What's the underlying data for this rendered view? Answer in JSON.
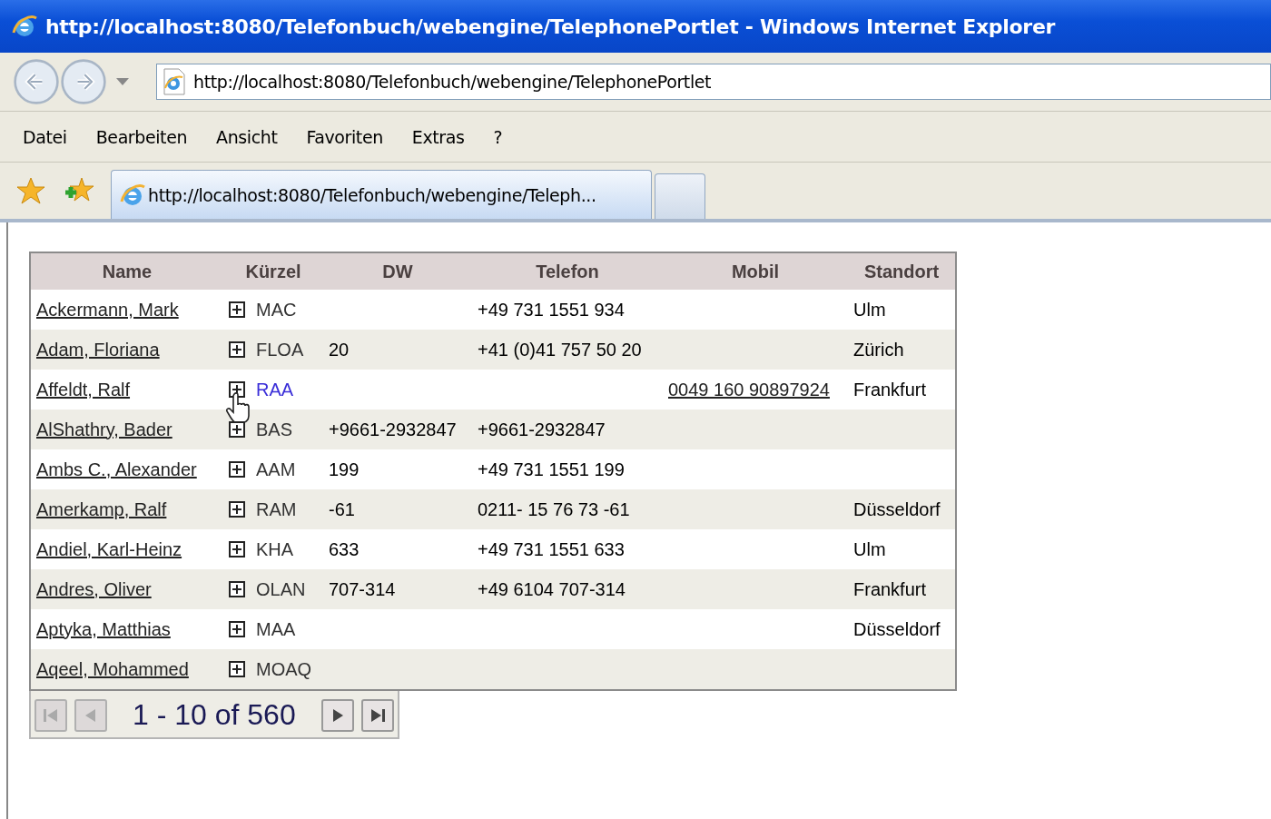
{
  "window": {
    "title": "http://localhost:8080/Telefonbuch/webengine/TelephonePortlet - Windows Internet Explorer"
  },
  "address_bar": {
    "value": "http://localhost:8080/Telefonbuch/webengine/TelephonePortlet"
  },
  "menu": [
    "Datei",
    "Bearbeiten",
    "Ansicht",
    "Favoriten",
    "Extras",
    "?"
  ],
  "tabs": [
    {
      "label": "http://localhost:8080/Telefonbuch/webengine/Teleph...",
      "selected": true
    }
  ],
  "table": {
    "columns": [
      "Name",
      "Kürzel",
      "DW",
      "Telefon",
      "Mobil",
      "Standort"
    ],
    "rows": [
      {
        "name": "Ackermann, Mark",
        "kuerzel": "MAC",
        "hovered": false,
        "dw": "",
        "telefon": "+49 731 1551 934",
        "mobil": "",
        "standort": "Ulm"
      },
      {
        "name": "Adam, Floriana",
        "kuerzel": "FLOA",
        "hovered": false,
        "dw": "20",
        "telefon": "+41 (0)41 757 50 20",
        "mobil": "",
        "standort": "Zürich"
      },
      {
        "name": "Affeldt, Ralf",
        "kuerzel": "RAA",
        "hovered": true,
        "dw": "",
        "telefon": "",
        "mobil": "0049 160 90897924",
        "standort": "Frankfurt"
      },
      {
        "name": "AlShathry, Bader",
        "kuerzel": "BAS",
        "hovered": false,
        "dw": "+9661-2932847",
        "telefon": "+9661-2932847",
        "mobil": "",
        "standort": ""
      },
      {
        "name": "Ambs C., Alexander",
        "kuerzel": "AAM",
        "hovered": false,
        "dw": "199",
        "telefon": "+49 731 1551 199",
        "mobil": "",
        "standort": ""
      },
      {
        "name": "Amerkamp, Ralf",
        "kuerzel": "RAM",
        "hovered": false,
        "dw": "-61",
        "telefon": "0211- 15 76 73 -61",
        "mobil": "",
        "standort": "Düsseldorf"
      },
      {
        "name": "Andiel, Karl-Heinz",
        "kuerzel": "KHA",
        "hovered": false,
        "dw": "633",
        "telefon": "+49 731 1551 633",
        "mobil": "",
        "standort": "Ulm"
      },
      {
        "name": "Andres, Oliver",
        "kuerzel": "OLAN",
        "hovered": false,
        "dw": "707-314",
        "telefon": "+49 6104 707-314",
        "mobil": "",
        "standort": "Frankfurt"
      },
      {
        "name": "Aptyka, Matthias",
        "kuerzel": "MAA",
        "hovered": false,
        "dw": "",
        "telefon": "",
        "mobil": "",
        "standort": "Düsseldorf"
      },
      {
        "name": "Aqeel, Mohammed",
        "kuerzel": "MOAQ",
        "hovered": false,
        "dw": "",
        "telefon": "",
        "mobil": "",
        "standort": ""
      }
    ]
  },
  "pager": {
    "first_disabled": true,
    "prev_disabled": true,
    "range": "1 - 10 of 560",
    "next_disabled": false,
    "last_disabled": false
  }
}
